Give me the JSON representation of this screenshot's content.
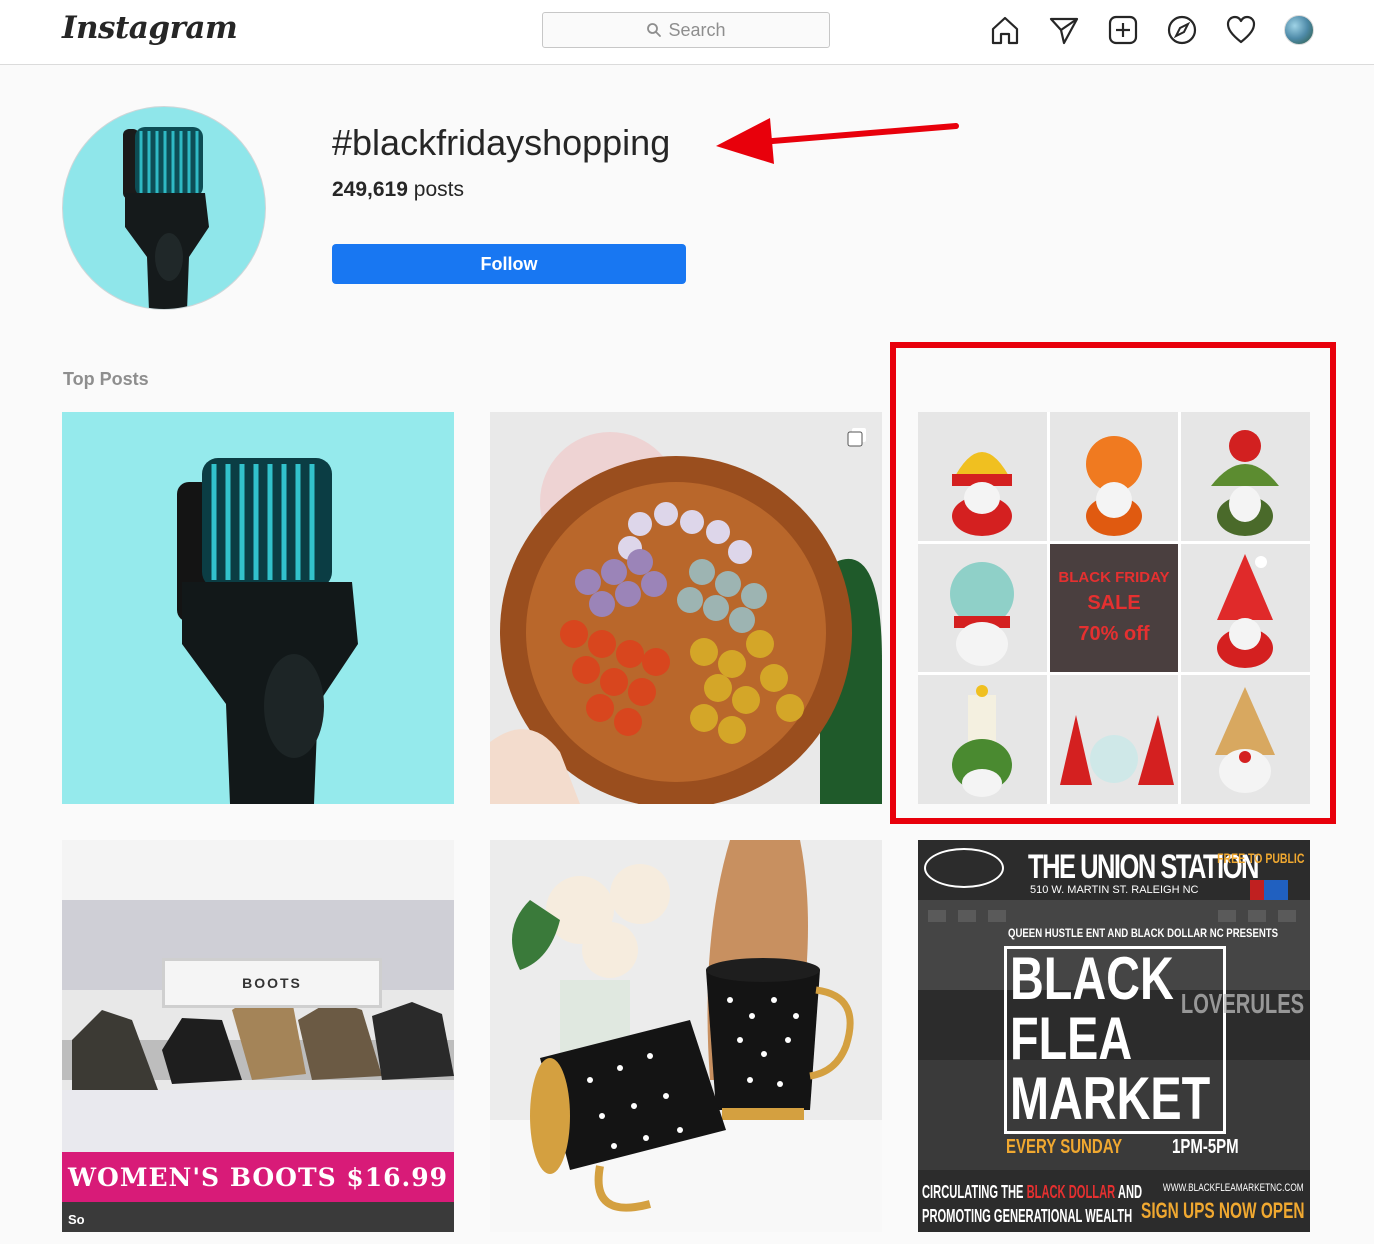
{
  "header": {
    "logo": "Instagram",
    "search_placeholder": "Search",
    "nav_icons": [
      "home-icon",
      "direct-message-icon",
      "new-post-icon",
      "explore-icon",
      "activity-heart-icon",
      "profile-avatar"
    ]
  },
  "tag": {
    "name": "#blackfridayshopping",
    "post_count": "249,619",
    "post_count_suffix": "posts",
    "follow_label": "Follow"
  },
  "section": {
    "title": "Top Posts"
  },
  "posts": {
    "gnomes": {
      "sale_line1": "BLACK FRIDAY",
      "sale_line2": "SALE",
      "sale_line3": "70% off"
    },
    "boots": {
      "banner": "WOMEN'S BOOTS $16.99",
      "sign": "BOOTS",
      "corner": "So"
    },
    "flea": {
      "title": "THE UNION STATION",
      "address": "510 W. MARTIN ST. RALEIGH NC",
      "free": "FREE TO PUBLIC",
      "presents": "QUEEN HUSTLE ENT AND BLACK DOLLAR NC PRESENTS",
      "big1": "BLACK",
      "big2": "FLEA",
      "big3": "MARKET",
      "every": "EVERY SUNDAY",
      "time": "1PM-5PM",
      "circ_a": "CIRCULATING THE ",
      "circ_red": "BLACK DOLLAR",
      "circ_b": " AND",
      "circ_line2": "PROMOTING GENERATIONAL WEALTH",
      "url": "WWW.BLACKFLEAMARKETNC.COM",
      "signup": "SIGN UPS NOW OPEN",
      "love": "LOVERULES"
    }
  },
  "colors": {
    "follow_button": "#1877f2",
    "annotation": "#e8000b",
    "boots_banner": "#d81b78",
    "sale_text": "#e53030"
  }
}
